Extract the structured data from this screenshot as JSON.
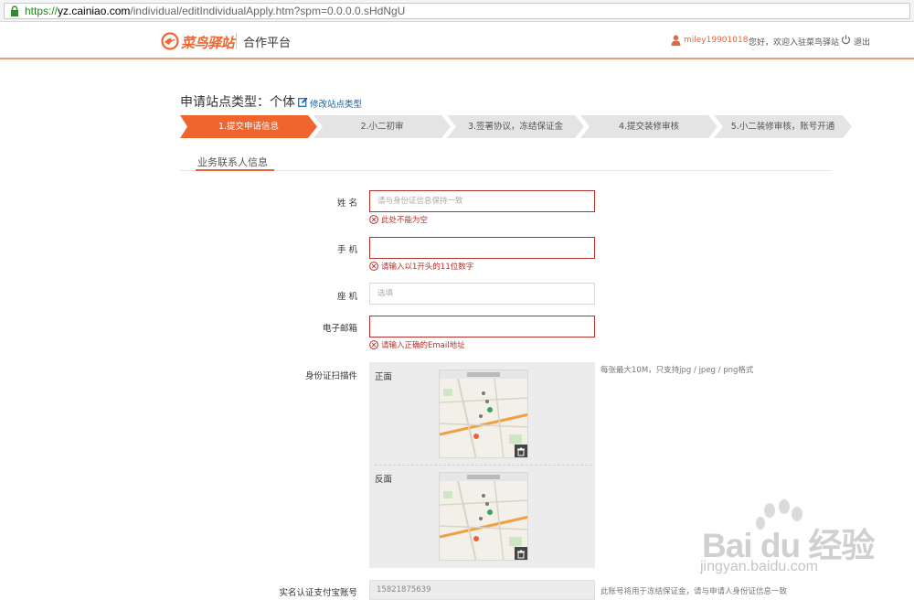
{
  "browser": {
    "url_https": "https://",
    "url_host": "yz.cainiao.com",
    "url_path": "/individual/editIndividualApply.htm?spm=0.0.0.0.sHdNgU"
  },
  "header": {
    "logo_text": "菜鸟驿站",
    "platform": "合作平台",
    "username": "miley19901018",
    "welcome": "您好，欢迎入驻菜鸟驿站",
    "logout": "退出",
    "accent_color": "#f0642e"
  },
  "page": {
    "title": "申请站点类型：个体",
    "edit_link": "修改站点类型"
  },
  "steps": [
    {
      "label": "1.提交申请信息",
      "active": true
    },
    {
      "label": "2.小二初审",
      "active": false
    },
    {
      "label": "3.签署协议，冻结保证金",
      "active": false
    },
    {
      "label": "4.提交装修审核",
      "active": false
    },
    {
      "label": "5.小二装修审核，账号开通",
      "active": false
    }
  ],
  "section": {
    "title": "业务联系人信息"
  },
  "form": {
    "name_label": "姓 名",
    "name_placeholder": "请与身份证信息保持一致",
    "name_error": "此处不能为空",
    "phone_label": "手 机",
    "phone_error": "请输入以1开头的11位数字",
    "landline_label": "座 机",
    "landline_placeholder": "选填",
    "email_label": "电子邮箱",
    "email_error": "请输入正确的Email地址",
    "idcard_label": "身份证扫描件",
    "front_label": "正面",
    "back_label": "反面",
    "idcard_hint": "每张最大10M，只支持jpg / jpeg / png格式",
    "alipay_label": "实名认证支付宝账号",
    "alipay_value": "15821875639",
    "alipay_hint": "此账号将用于冻结保证金，请与申请人身份证信息一致"
  },
  "watermark": {
    "text": "Bai du 经验",
    "url": "jingyan.baidu.com"
  }
}
